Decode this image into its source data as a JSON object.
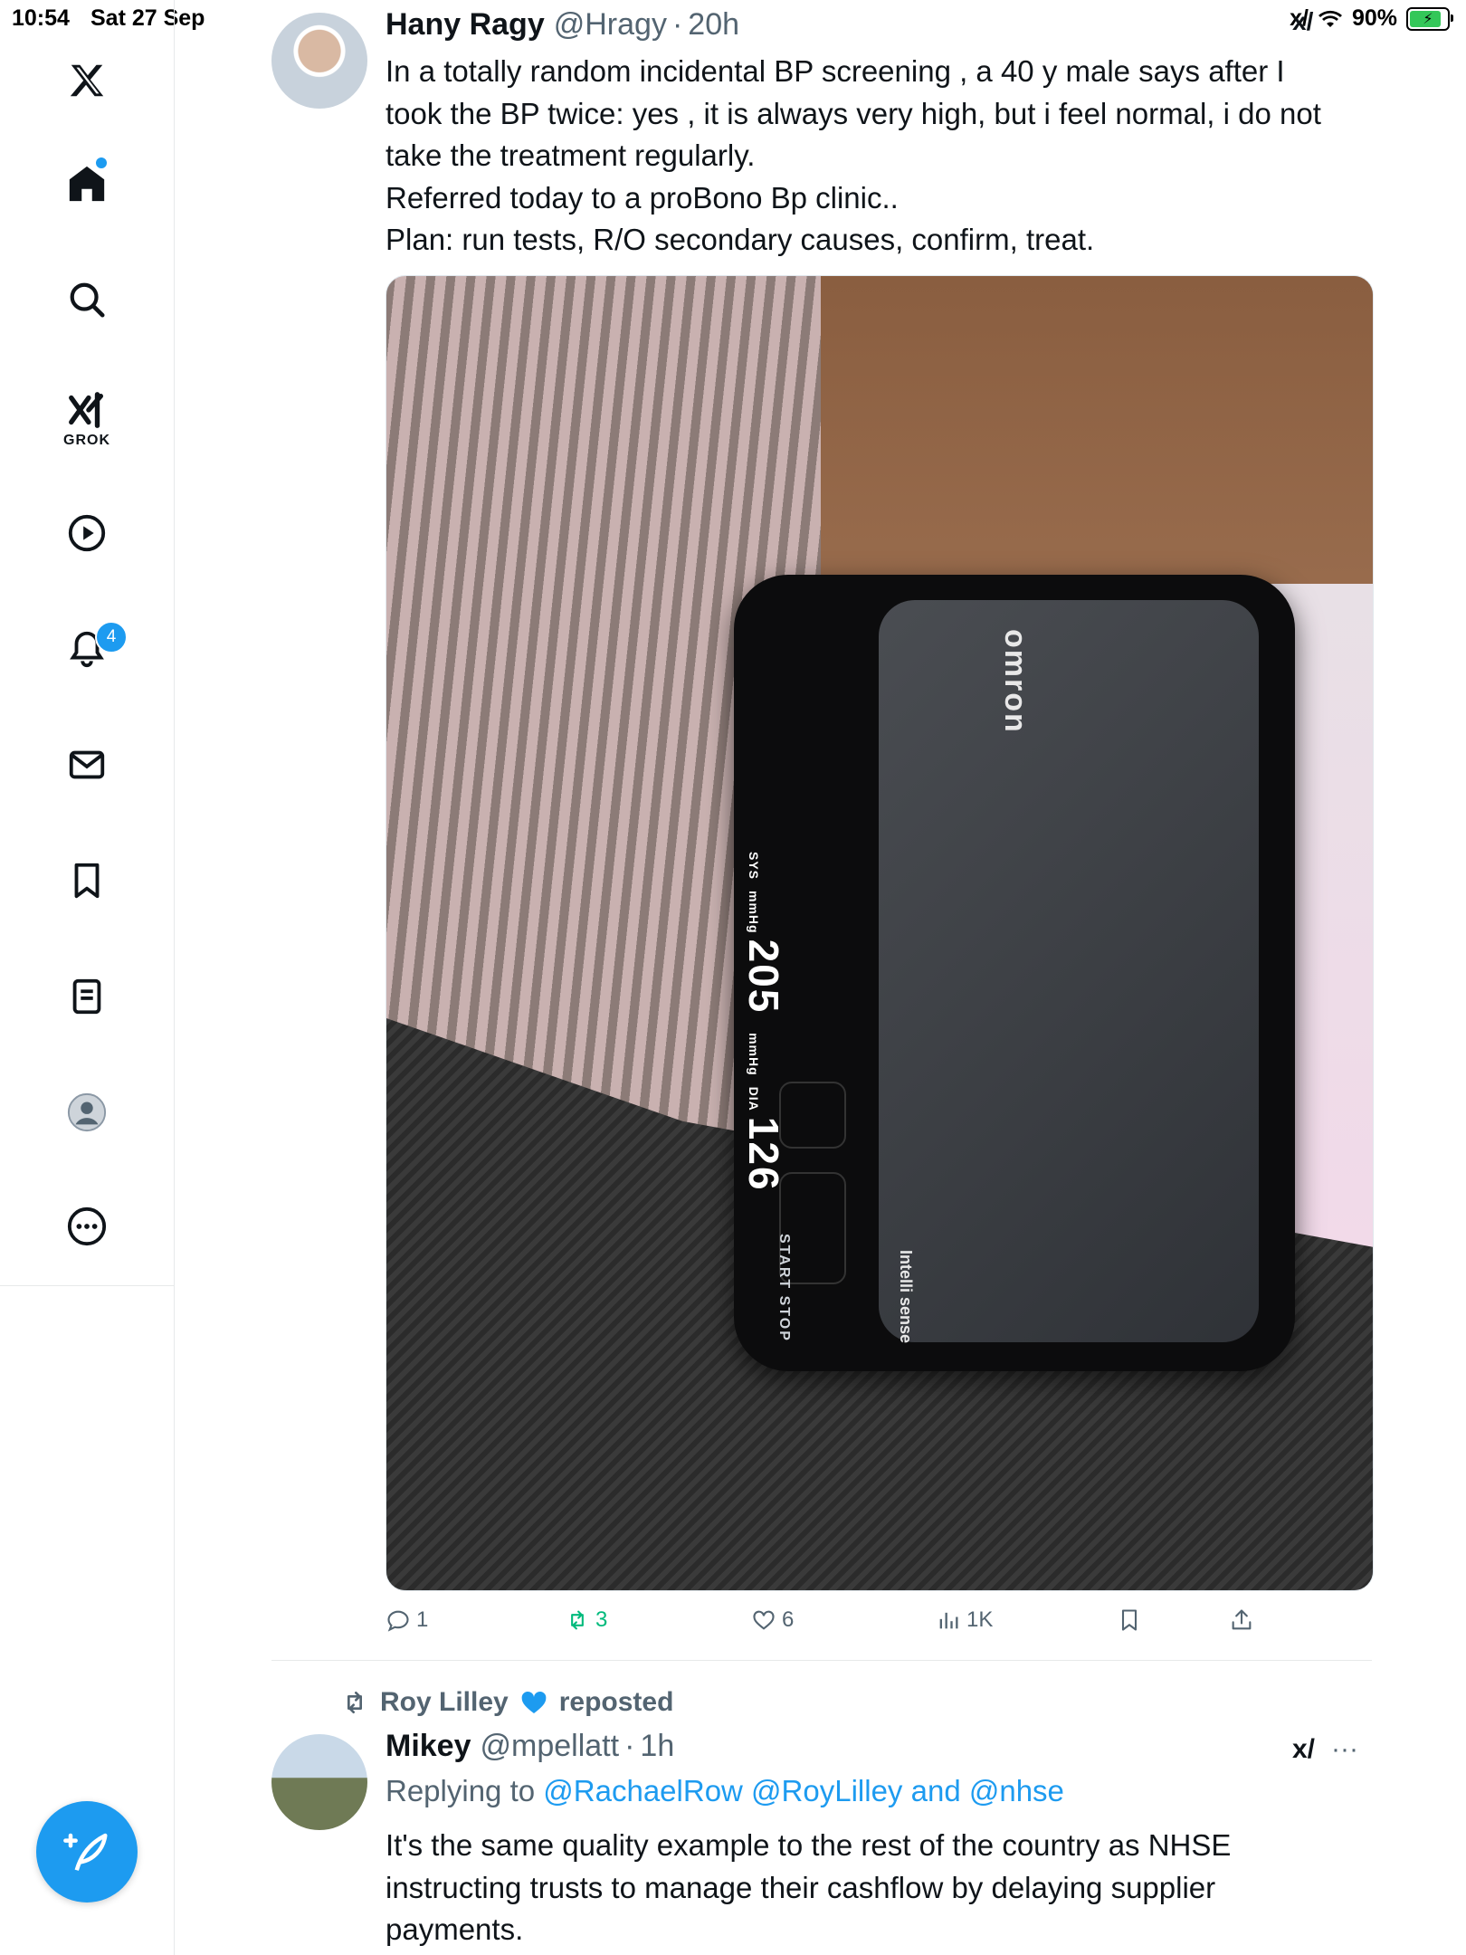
{
  "status_bar": {
    "time": "10:54",
    "date": "Sat 27 Sep",
    "battery": "90%"
  },
  "sidebar": {
    "items": [
      {
        "name": "home",
        "icon": "home-icon"
      },
      {
        "name": "explore",
        "icon": "search-icon"
      },
      {
        "name": "grok",
        "icon": "grok-icon",
        "label": "GROK"
      },
      {
        "name": "videos",
        "icon": "play-icon"
      },
      {
        "name": "notifications",
        "icon": "bell-icon",
        "badge": "4"
      },
      {
        "name": "messages",
        "icon": "mail-icon"
      },
      {
        "name": "bookmarks",
        "icon": "bookmark-icon"
      },
      {
        "name": "lists",
        "icon": "list-icon"
      },
      {
        "name": "profile",
        "icon": "profile-icon"
      },
      {
        "name": "more",
        "icon": "more-icon"
      }
    ],
    "compose_icon": "compose-icon"
  },
  "tweet1": {
    "name": "Hany Ragy",
    "handle": "@Hragy",
    "separator": "·",
    "time": "20h",
    "lines": [
      "In a totally random incidental BP screening , a 40 y male says after I",
      "took the BP twice: yes , it is always very high, but i feel normal, i do not",
      "take the treatment regularly.",
      "Referred today to a proBono Bp clinic..",
      "Plan: run tests, R/O secondary causes, confirm, treat."
    ],
    "photo": {
      "brand": "omron",
      "sys_label": "SYS",
      "unit1": "mmHg",
      "sys": "205",
      "dia_label": "DIA",
      "unit2": "mmHg",
      "dia": "126",
      "start": "START",
      "stop": "STOP",
      "intelli": "Intelli sense"
    },
    "actions": {
      "replies": "1",
      "reposts": "3",
      "likes": "6",
      "views": "1K"
    }
  },
  "tweet2": {
    "reposted_by": "Roy Lilley",
    "reposted_suffix": "reposted",
    "name": "Mikey",
    "handle": "@mpellatt",
    "separator": "·",
    "time": "1h",
    "replying_prefix": "Replying to",
    "mention1": "@RachaelRow",
    "mention2": "@RoyLilley",
    "and": "and",
    "mention3": "@nhse",
    "lines": [
      "It's the same quality example to the rest of the country as NHSE",
      "instructing trusts to manage their cashflow by delaying supplier",
      "payments."
    ]
  },
  "colors": {
    "accent": "#1d9bf0",
    "repost_green": "#00ba7c",
    "muted": "#536471"
  }
}
